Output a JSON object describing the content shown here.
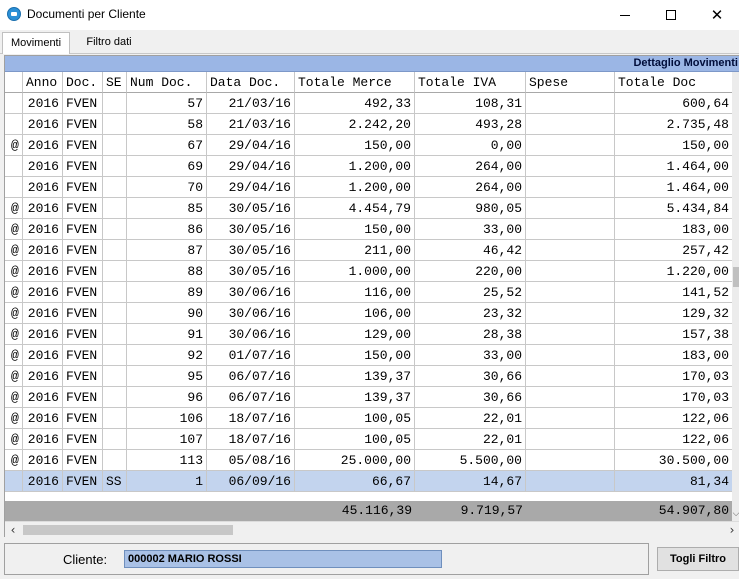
{
  "window": {
    "title": "Documenti per Cliente",
    "minimize_icon": "minimize-icon",
    "maximize_icon": "maximize-icon",
    "close_icon": "close-icon",
    "close_glyph": "✕"
  },
  "tabs": [
    {
      "label": "Movimenti",
      "active": true
    },
    {
      "label": "Filtro dati",
      "active": false
    }
  ],
  "grid": {
    "band_title": "Dettaglio Movimenti",
    "band_color": "#9bb6e5",
    "columns": [
      "",
      "Anno",
      "Doc.",
      "SE",
      "Num Doc.",
      "Data Doc.",
      "Totale Merce",
      "Totale IVA",
      "Spese",
      "Totale Doc"
    ],
    "rows": [
      {
        "flag": "",
        "anno": "2016",
        "doc": "FVEN",
        "se": "",
        "num": "57",
        "data": "21/03/16",
        "merce": "492,33",
        "iva": "108,31",
        "spese": "",
        "totale": "600,64"
      },
      {
        "flag": "",
        "anno": "2016",
        "doc": "FVEN",
        "se": "",
        "num": "58",
        "data": "21/03/16",
        "merce": "2.242,20",
        "iva": "493,28",
        "spese": "",
        "totale": "2.735,48"
      },
      {
        "flag": "@",
        "anno": "2016",
        "doc": "FVEN",
        "se": "",
        "num": "67",
        "data": "29/04/16",
        "merce": "150,00",
        "iva": "0,00",
        "spese": "",
        "totale": "150,00"
      },
      {
        "flag": "",
        "anno": "2016",
        "doc": "FVEN",
        "se": "",
        "num": "69",
        "data": "29/04/16",
        "merce": "1.200,00",
        "iva": "264,00",
        "spese": "",
        "totale": "1.464,00"
      },
      {
        "flag": "",
        "anno": "2016",
        "doc": "FVEN",
        "se": "",
        "num": "70",
        "data": "29/04/16",
        "merce": "1.200,00",
        "iva": "264,00",
        "spese": "",
        "totale": "1.464,00"
      },
      {
        "flag": "@",
        "anno": "2016",
        "doc": "FVEN",
        "se": "",
        "num": "85",
        "data": "30/05/16",
        "merce": "4.454,79",
        "iva": "980,05",
        "spese": "",
        "totale": "5.434,84"
      },
      {
        "flag": "@",
        "anno": "2016",
        "doc": "FVEN",
        "se": "",
        "num": "86",
        "data": "30/05/16",
        "merce": "150,00",
        "iva": "33,00",
        "spese": "",
        "totale": "183,00"
      },
      {
        "flag": "@",
        "anno": "2016",
        "doc": "FVEN",
        "se": "",
        "num": "87",
        "data": "30/05/16",
        "merce": "211,00",
        "iva": "46,42",
        "spese": "",
        "totale": "257,42"
      },
      {
        "flag": "@",
        "anno": "2016",
        "doc": "FVEN",
        "se": "",
        "num": "88",
        "data": "30/05/16",
        "merce": "1.000,00",
        "iva": "220,00",
        "spese": "",
        "totale": "1.220,00"
      },
      {
        "flag": "@",
        "anno": "2016",
        "doc": "FVEN",
        "se": "",
        "num": "89",
        "data": "30/06/16",
        "merce": "116,00",
        "iva": "25,52",
        "spese": "",
        "totale": "141,52"
      },
      {
        "flag": "@",
        "anno": "2016",
        "doc": "FVEN",
        "se": "",
        "num": "90",
        "data": "30/06/16",
        "merce": "106,00",
        "iva": "23,32",
        "spese": "",
        "totale": "129,32"
      },
      {
        "flag": "@",
        "anno": "2016",
        "doc": "FVEN",
        "se": "",
        "num": "91",
        "data": "30/06/16",
        "merce": "129,00",
        "iva": "28,38",
        "spese": "",
        "totale": "157,38"
      },
      {
        "flag": "@",
        "anno": "2016",
        "doc": "FVEN",
        "se": "",
        "num": "92",
        "data": "01/07/16",
        "merce": "150,00",
        "iva": "33,00",
        "spese": "",
        "totale": "183,00"
      },
      {
        "flag": "@",
        "anno": "2016",
        "doc": "FVEN",
        "se": "",
        "num": "95",
        "data": "06/07/16",
        "merce": "139,37",
        "iva": "30,66",
        "spese": "",
        "totale": "170,03"
      },
      {
        "flag": "@",
        "anno": "2016",
        "doc": "FVEN",
        "se": "",
        "num": "96",
        "data": "06/07/16",
        "merce": "139,37",
        "iva": "30,66",
        "spese": "",
        "totale": "170,03"
      },
      {
        "flag": "@",
        "anno": "2016",
        "doc": "FVEN",
        "se": "",
        "num": "106",
        "data": "18/07/16",
        "merce": "100,05",
        "iva": "22,01",
        "spese": "",
        "totale": "122,06"
      },
      {
        "flag": "@",
        "anno": "2016",
        "doc": "FVEN",
        "se": "",
        "num": "107",
        "data": "18/07/16",
        "merce": "100,05",
        "iva": "22,01",
        "spese": "",
        "totale": "122,06"
      },
      {
        "flag": "@",
        "anno": "2016",
        "doc": "FVEN",
        "se": "",
        "num": "113",
        "data": "05/08/16",
        "merce": "25.000,00",
        "iva": "5.500,00",
        "spese": "",
        "totale": "30.500,00"
      },
      {
        "flag": "",
        "anno": "2016",
        "doc": "FVEN",
        "se": "SS",
        "num": "1",
        "data": "06/09/16",
        "merce": "66,67",
        "iva": "14,67",
        "spese": "",
        "totale": "81,34",
        "selected": true
      }
    ],
    "totals": {
      "merce": "45.116,39",
      "iva": "9.719,57",
      "totale": "54.907,80"
    },
    "selected_row_color": "#c3d4ee"
  },
  "footer": {
    "cliente_label": "Cliente:",
    "cliente_value": "000002 MARIO ROSSI",
    "toggle_filter_label": "Togli Filtro"
  }
}
